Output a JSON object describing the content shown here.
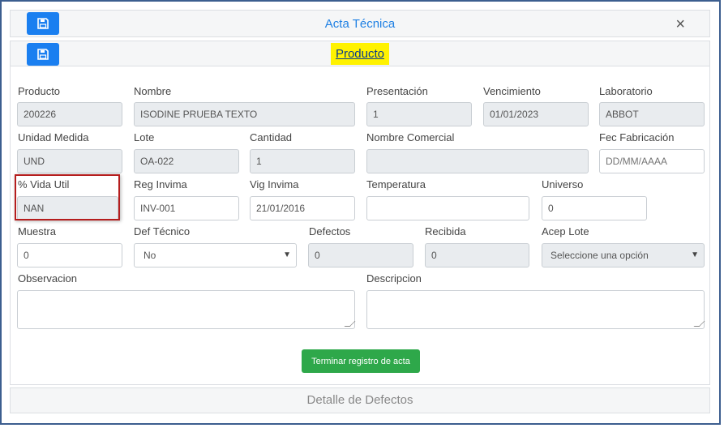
{
  "header": {
    "title": "Acta Técnica",
    "close_label": "×"
  },
  "section": {
    "title": "Producto"
  },
  "labels": {
    "producto": "Producto",
    "nombre": "Nombre",
    "presentacion": "Presentación",
    "vencimiento": "Vencimiento",
    "laboratorio": "Laboratorio",
    "unidad_medida": "Unidad Medida",
    "lote": "Lote",
    "cantidad": "Cantidad",
    "nombre_comercial": "Nombre Comercial",
    "fec_fabricacion": "Fec Fabricación",
    "vida_util": "% Vida Util",
    "reg_invima": "Reg Invima",
    "vig_invima": "Vig Invima",
    "temperatura": "Temperatura",
    "universo": "Universo",
    "muestra": "Muestra",
    "def_tecnico": "Def Técnico",
    "defectos": "Defectos",
    "recibida": "Recibida",
    "acep_lote": "Acep Lote",
    "observacion": "Observacion",
    "descripcion": "Descripcion"
  },
  "values": {
    "producto": "200226",
    "nombre": "ISODINE PRUEBA TEXTO",
    "presentacion": "1",
    "vencimiento": "01/01/2023",
    "laboratorio": "ABBOT",
    "unidad_medida": "UND",
    "lote": "OA-022",
    "cantidad": "1",
    "nombre_comercial": "",
    "fec_fabricacion_placeholder": "DD/MM/AAAA",
    "vida_util": "NAN",
    "reg_invima": "INV-001",
    "vig_invima": "21/01/2016",
    "temperatura": "",
    "universo": "0",
    "muestra": "0",
    "def_tecnico": "No",
    "defectos": "0",
    "recibida": "0",
    "acep_lote": "Seleccione una opción"
  },
  "actions": {
    "finish": "Terminar registro de acta"
  },
  "footer": {
    "title": "Detalle de Defectos"
  },
  "colors": {
    "accent": "#1a7ff0",
    "success": "#2ea84a",
    "highlight": "#fff200",
    "outline": "#b51d1d"
  }
}
